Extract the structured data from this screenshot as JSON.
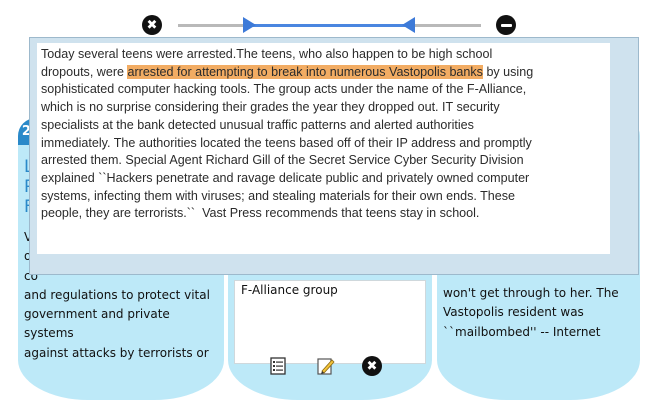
{
  "top_control": {
    "close_glyph": "✖",
    "left_icon": "close-circle-icon",
    "right_icon": "minus-circle-icon"
  },
  "left_panel": {
    "badge": "20",
    "title_letters": [
      "L",
      "P",
      "F"
    ],
    "text_lines": [
      "Va",
      "or",
      "co",
      "and regulations to protect vital",
      "government and private systems",
      "against attacks by terrorists or"
    ]
  },
  "center_panel": {
    "box_text": "F-Alliance group",
    "icons": [
      "list-icon",
      "edit-icon",
      "close-icon"
    ],
    "close_glyph": "✖"
  },
  "right_panel": {
    "text_lines": [
      "won't get through to her. The",
      "Vastopolis resident was",
      "``mailbombed'' -- Internet"
    ]
  },
  "article": {
    "before": "Today several teens were arrested.The teens, who also happen to be high school\ndropouts, were ",
    "highlight": "arrested for attempting to break into numerous Vastopolis banks",
    "after": " by using\nsophisticated computer hacking tools. The group acts under the name of the F-Alliance,\nwhich is no surprise considering their grades the year they dropped out. IT security\nspecialists at the bank detected unusual traffic patterns and alerted authorities\nimmediately. The authorities located the teens based off of their IP address and promptly\narrested them. Special Agent Richard Gill of the Secret Service Cyber Security Division\nexplained ``Hackers penetrate and ravage delicate public and privately owned computer\nsystems, infecting them with viruses; and stealing materials for their own ends. These\npeople, they are terrorists.``  Vast Press recommends that teens stay in school.",
    "highlight_color": "#f2ac63"
  }
}
